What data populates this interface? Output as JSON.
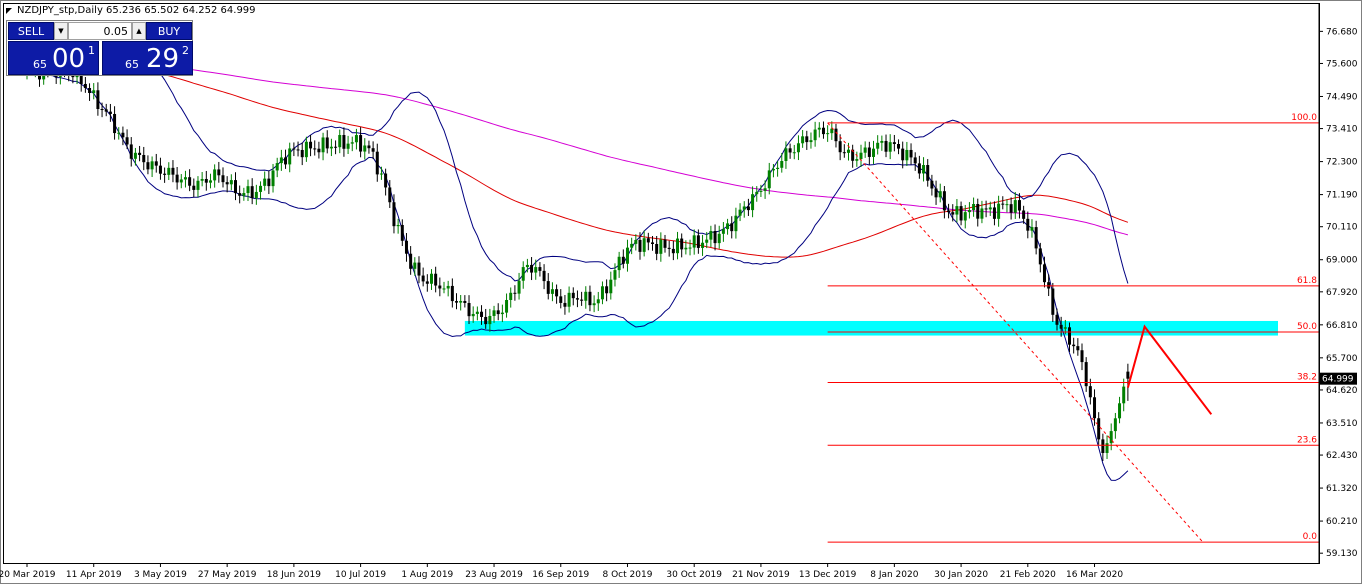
{
  "header": {
    "symbol_info": "NZDJPY_stp,Daily  65.236 65.502 64.252 64.999"
  },
  "trade_panel": {
    "sell_label": "SELL",
    "buy_label": "BUY",
    "lot": "0.05",
    "sell_price": {
      "prefix": "65",
      "big": "00",
      "sup": "1"
    },
    "buy_price": {
      "prefix": "65",
      "big": "29",
      "sup": "2"
    }
  },
  "colors": {
    "fib": "#ff0000",
    "zone": "#00ffff",
    "bollinger": "#000080",
    "ma_red": "#e00000",
    "ma_magenta": "#d400d4",
    "bull": "#008000",
    "bear": "#000000"
  },
  "chart_data": {
    "type": "candlestick",
    "symbol": "NZDJPY_stp",
    "timeframe": "Daily",
    "ohlc_last": {
      "open": 65.236,
      "high": 65.502,
      "low": 64.252,
      "close": 64.999
    },
    "current_price": "64.999",
    "ylim": [
      58.8,
      77.6
    ],
    "y_ticks": [
      "76.680",
      "75.600",
      "74.490",
      "73.410",
      "72.300",
      "71.190",
      "70.110",
      "69.000",
      "67.920",
      "66.810",
      "65.700",
      "64.620",
      "63.510",
      "62.430",
      "61.320",
      "60.210",
      "59.130"
    ],
    "x_ticks": [
      "20 Mar 2019",
      "11 Apr 2019",
      "3 May 2019",
      "27 May 2019",
      "18 Jun 2019",
      "10 Jul 2019",
      "1 Aug 2019",
      "23 Aug 2019",
      "16 Sep 2019",
      "8 Oct 2019",
      "30 Oct 2019",
      "21 Nov 2019",
      "13 Dec 2019",
      "8 Jan 2020",
      "30 Jan 2020",
      "21 Feb 2020",
      "16 Mar 2020"
    ],
    "x_tick_index": [
      0,
      16,
      32,
      48,
      64,
      80,
      96,
      112,
      128,
      144,
      160,
      176,
      192,
      208,
      224,
      240,
      256
    ],
    "bar_count": 265,
    "price_path": [
      [
        0,
        75.3
      ],
      [
        6,
        75.4
      ],
      [
        12,
        75.3
      ],
      [
        16,
        74.4
      ],
      [
        20,
        73.8
      ],
      [
        24,
        72.7
      ],
      [
        28,
        72.3
      ],
      [
        32,
        72.0
      ],
      [
        36,
        71.8
      ],
      [
        40,
        71.4
      ],
      [
        46,
        72.0
      ],
      [
        50,
        71.2
      ],
      [
        56,
        71.3
      ],
      [
        62,
        72.6
      ],
      [
        70,
        72.8
      ],
      [
        80,
        73.0
      ],
      [
        84,
        72.4
      ],
      [
        86,
        71.3
      ],
      [
        90,
        69.5
      ],
      [
        94,
        68.3
      ],
      [
        98,
        68.3
      ],
      [
        104,
        67.5
      ],
      [
        110,
        66.9
      ],
      [
        116,
        67.6
      ],
      [
        120,
        69.1
      ],
      [
        124,
        68.3
      ],
      [
        128,
        67.4
      ],
      [
        132,
        67.9
      ],
      [
        136,
        67.4
      ],
      [
        140,
        68.3
      ],
      [
        144,
        69.5
      ],
      [
        148,
        69.6
      ],
      [
        152,
        69.4
      ],
      [
        156,
        69.4
      ],
      [
        162,
        69.6
      ],
      [
        168,
        70.0
      ],
      [
        172,
        70.8
      ],
      [
        176,
        71.3
      ],
      [
        180,
        72.3
      ],
      [
        186,
        73.0
      ],
      [
        190,
        73.3
      ],
      [
        192,
        73.6
      ],
      [
        196,
        72.4
      ],
      [
        200,
        72.5
      ],
      [
        206,
        73.0
      ],
      [
        210,
        72.6
      ],
      [
        214,
        72.2
      ],
      [
        218,
        71.2
      ],
      [
        222,
        70.4
      ],
      [
        226,
        70.7
      ],
      [
        232,
        70.6
      ],
      [
        236,
        71.0
      ],
      [
        240,
        70.3
      ],
      [
        244,
        68.6
      ],
      [
        246,
        66.8
      ],
      [
        250,
        66.5
      ],
      [
        254,
        65.2
      ],
      [
        256,
        63.8
      ],
      [
        258,
        61.5
      ],
      [
        260,
        63.2
      ],
      [
        262,
        64.6
      ],
      [
        264,
        64.999
      ]
    ],
    "annotations": {
      "fib_levels": [
        {
          "label": "100.0",
          "price": 73.6
        },
        {
          "label": "61.8",
          "price": 68.12
        },
        {
          "label": "50.0",
          "price": 66.57
        },
        {
          "label": "38.2",
          "price": 64.87
        },
        {
          "label": "23.6",
          "price": 62.76
        },
        {
          "label": "0.0",
          "price": 59.5
        }
      ],
      "fib_start": {
        "bar": 192,
        "price": 73.6
      },
      "fib_end": {
        "bar": 282,
        "price": 59.5
      },
      "support_zone": {
        "bar_from": 105,
        "bar_to": 300,
        "price_low": 66.45,
        "price_high": 66.94
      },
      "projection": [
        {
          "bar": 264,
          "price": 64.7
        },
        {
          "bar": 268,
          "price": 66.75
        },
        {
          "bar": 284,
          "price": 63.8
        }
      ]
    },
    "xlabel": "",
    "ylabel": "",
    "grid": false
  }
}
